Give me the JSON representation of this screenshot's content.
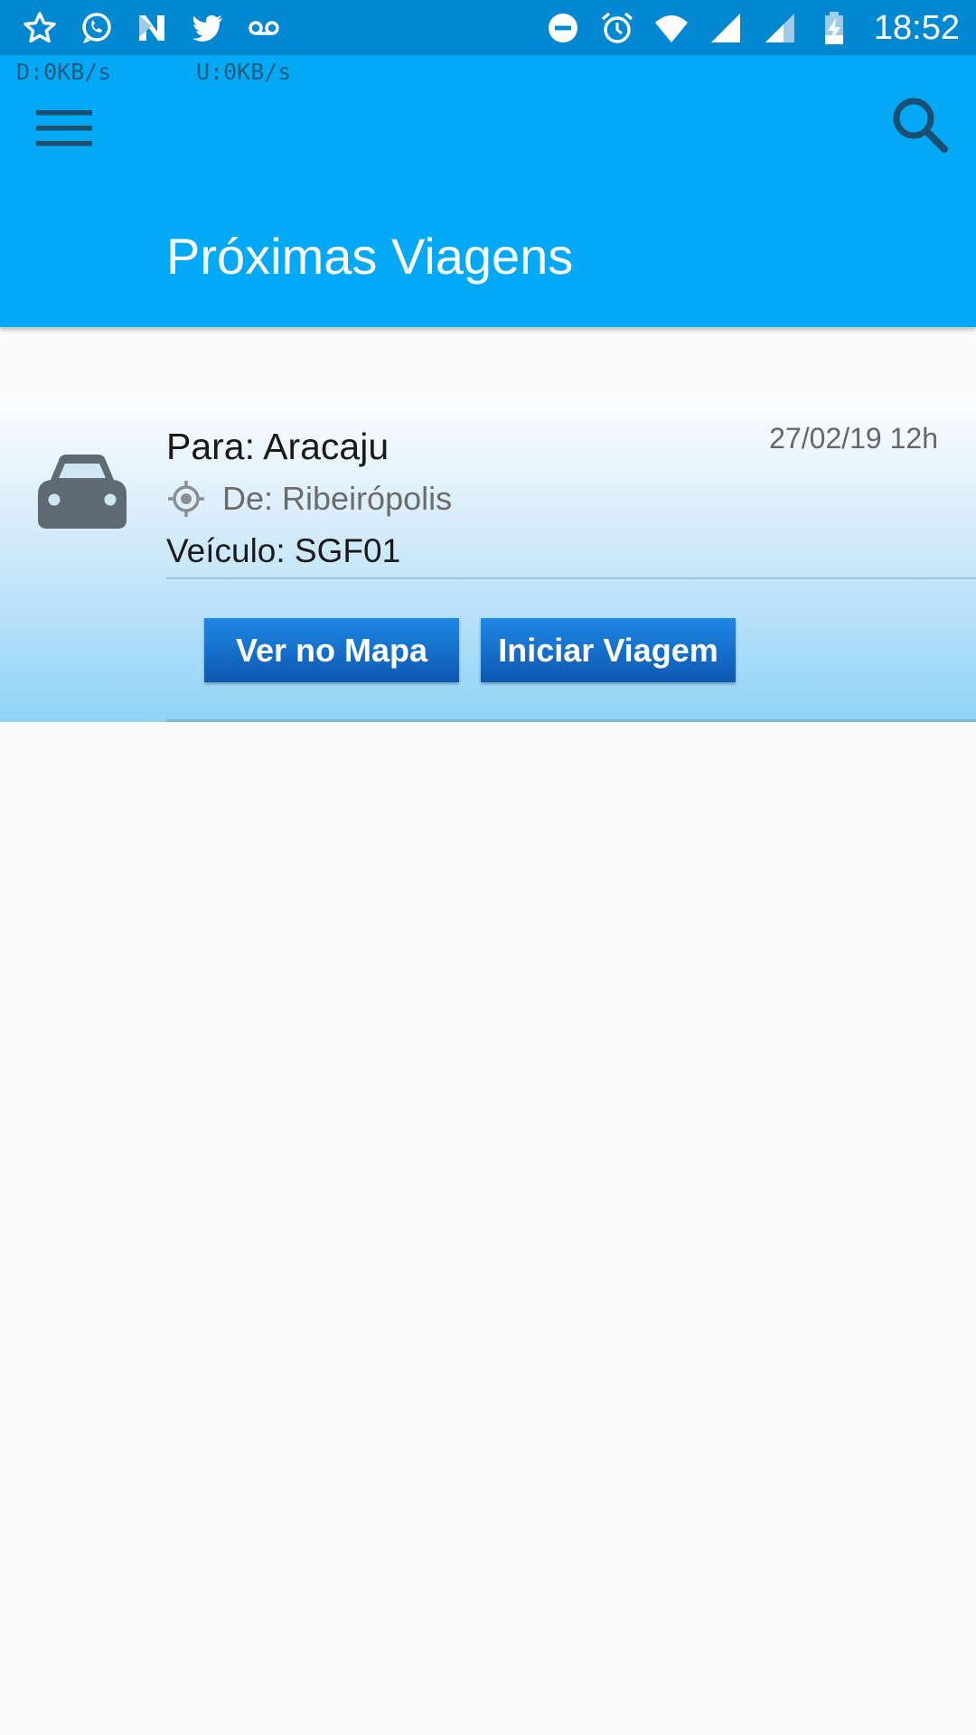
{
  "status_bar": {
    "time": "18:52",
    "left_icons": [
      "star-icon",
      "whatsapp-icon",
      "n-app-icon",
      "twitter-icon",
      "voicemail-icon"
    ],
    "right_icons": [
      "do-not-disturb-icon",
      "alarm-icon",
      "wifi-icon",
      "signal-icon",
      "signal-icon",
      "battery-charging-icon"
    ]
  },
  "network": {
    "download": "D:0KB/s",
    "upload": "U:0KB/s"
  },
  "app_bar": {
    "title": "Próximas Viagens",
    "menu_icon": "menu-icon",
    "search_icon": "search-icon",
    "color": "#03a9f4"
  },
  "trips": [
    {
      "destination": "Para: Aracaju",
      "date": "27/02/19 12h",
      "origin": "De: Ribeirópolis",
      "vehicle": "Veículo: SGF01",
      "icon": "car-icon",
      "buttons": {
        "map": "Ver no Mapa",
        "start": "Iniciar Viagem"
      }
    }
  ],
  "colors": {
    "status_bar": "#0288d1",
    "button": "#1565c0"
  }
}
